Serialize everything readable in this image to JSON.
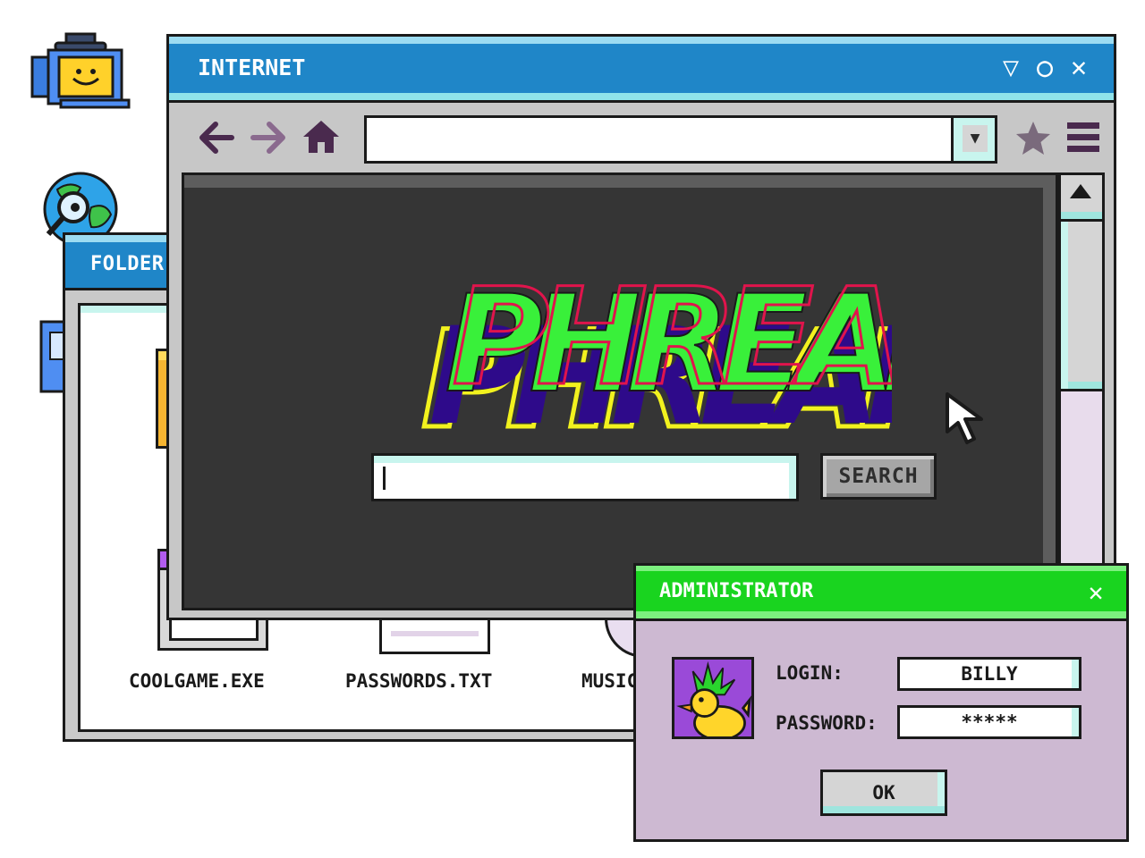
{
  "folder_window": {
    "title": "FOLDER",
    "files": [
      {
        "label": "COOLGAME.EXE"
      },
      {
        "label": "PASSWORDS.TXT"
      },
      {
        "label": "MUSIC"
      }
    ]
  },
  "browser": {
    "title": "INTERNET",
    "title_controls": {
      "minimize": "▽",
      "maximize": "○",
      "close": "✕"
    },
    "address": {
      "value": "",
      "placeholder": ""
    },
    "logo_text": "PHREAK",
    "search": {
      "value": "",
      "placeholder": "",
      "button_label": "SEARCH"
    }
  },
  "admin_dialog": {
    "title": "ADMINISTRATOR",
    "close_glyph": "✕",
    "login_label": "LOGIN:",
    "login_value": "BILLY",
    "password_label": "PASSWORD:",
    "password_value": "*****",
    "ok_label": "OK"
  },
  "colors": {
    "titlebar_blue": "#1f86c8",
    "titlebar_green": "#19d41f",
    "logo_green": "#39f03a",
    "logo_red": "#e0144c",
    "logo_purple": "#2e0a8a",
    "logo_yellow": "#f2f21e",
    "dialog_bg": "#cdb9d2"
  },
  "icons": [
    "computer-icon",
    "globe-magnifier-icon",
    "document-icon",
    "back-arrow-icon",
    "forward-arrow-icon",
    "home-icon",
    "dropdown-icon",
    "star-icon",
    "hamburger-menu-icon",
    "mouse-cursor-icon",
    "scroll-up-icon",
    "duck-avatar-icon"
  ]
}
